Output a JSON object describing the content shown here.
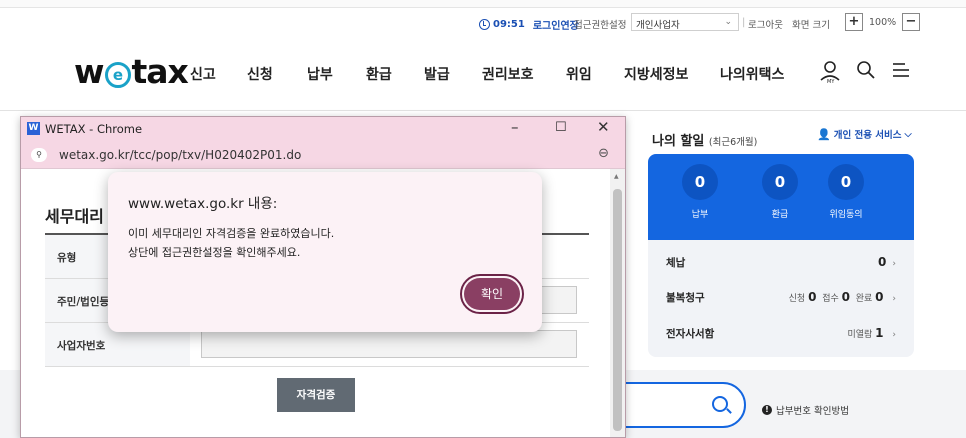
{
  "utility_bar": {
    "clock_time": "09:51",
    "extend_login": "로그인연장",
    "access_label": "접근권한설정",
    "access_value": "개인사업자",
    "logout": "로그아웃",
    "screen_size_label": "화면 크기",
    "zoom_in": "+",
    "zoom_value": "100%",
    "zoom_out": "−"
  },
  "nav": {
    "logo": {
      "pre": "w",
      "mid": "e",
      "post": "tax"
    },
    "items": [
      "신고",
      "신청",
      "납부",
      "환급",
      "발급",
      "권리보호",
      "위임",
      "지방세정보",
      "나의위택스"
    ],
    "icons": [
      "user-icon",
      "search-icon",
      "menu-icon"
    ]
  },
  "my_panel": {
    "title": "나의 할일",
    "period": "(최근6개월)",
    "service_link": "개인 전용 서비스",
    "stats": [
      {
        "value": "0",
        "label": "납부"
      },
      {
        "value": "0",
        "label": "환급"
      },
      {
        "value": "0",
        "label": "위임동의"
      }
    ],
    "rows": {
      "arrears": {
        "label": "체납",
        "value": "0"
      },
      "objection": {
        "label": "불복청구",
        "apply_label": "신청",
        "apply_value": "0",
        "receive_label": "접수",
        "receive_value": "0",
        "done_label": "완료",
        "done_value": "0"
      },
      "epost": {
        "label": "전자사서함",
        "unread_label": "미열람",
        "unread_value": "1"
      }
    }
  },
  "bottom": {
    "pay_help": "납부번호 확인방법"
  },
  "popup": {
    "window_title": "WETAX - Chrome",
    "url": "wetax.go.kr/tcc/pop/txv/H020402P01.do",
    "heading": "세무대리",
    "rows": [
      "유형",
      "주민/법인등",
      "사업자번호"
    ],
    "verify_button": "자격검증"
  },
  "alert": {
    "host": "www.wetax.go.kr 내용:",
    "line1": "이미 세무대리인 자격검증을 완료하였습니다.",
    "line2": "상단에 접근권한설정을 확인해주세요.",
    "ok_button": "확인"
  },
  "colors": {
    "brand_blue": "#1466e0",
    "popup_title_bg": "#f6d7e4",
    "ok_button": "#8a3f63"
  }
}
